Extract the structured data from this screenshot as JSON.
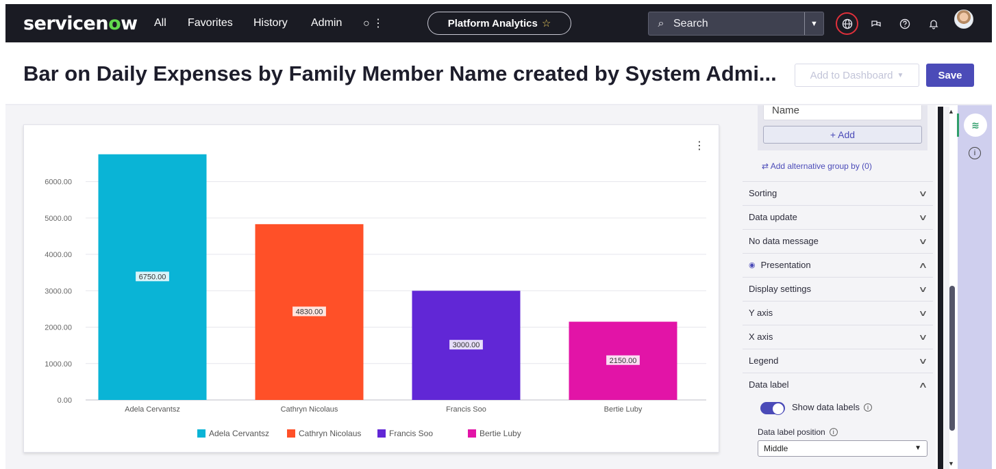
{
  "nav": {
    "logo_prefix": "servicen",
    "logo_o": "o",
    "logo_suffix": "w",
    "links": [
      "All",
      "Favorites",
      "History",
      "Admin"
    ],
    "more": "○ ⋮",
    "pill_label": "Platform Analytics",
    "search_placeholder": "Search"
  },
  "header": {
    "title": "Bar on Daily Expenses by Family Member Name created by System Admi...",
    "add_to_dashboard": "Add to Dashboard",
    "save": "Save"
  },
  "chart_data": {
    "type": "bar",
    "categories": [
      "Adela Cervantsz",
      "Cathryn Nicolaus",
      "Francis Soo",
      "Bertie Luby"
    ],
    "values": [
      6750.0,
      4830.0,
      3000.0,
      2150.0
    ],
    "value_labels": [
      "6750.00",
      "4830.00",
      "3000.00",
      "2150.00"
    ],
    "colors": [
      "#0ab4d6",
      "#ff5028",
      "#6127d6",
      "#e214a7"
    ],
    "y_ticks": [
      "0.00",
      "1000.00",
      "2000.00",
      "3000.00",
      "4000.00",
      "5000.00",
      "6000.00"
    ],
    "ylim": [
      0,
      6800
    ],
    "legend": [
      "Adela Cervantsz",
      "Cathryn Nicolaus",
      "Francis Soo",
      "Bertie Luby"
    ],
    "legend_position": "bottom",
    "grid": true,
    "title": "",
    "xlabel": "",
    "ylabel": ""
  },
  "panel": {
    "group_field": "Name",
    "add": "+ Add",
    "alt_group": "Add alternative group by (0)",
    "sections": [
      "Sorting",
      "Data update",
      "No data message",
      "Presentation",
      "Display settings",
      "Y axis",
      "X axis",
      "Legend",
      "Data label"
    ],
    "show_data_labels": "Show data labels",
    "data_label_position_label": "Data label position",
    "data_label_position": "Middle"
  }
}
